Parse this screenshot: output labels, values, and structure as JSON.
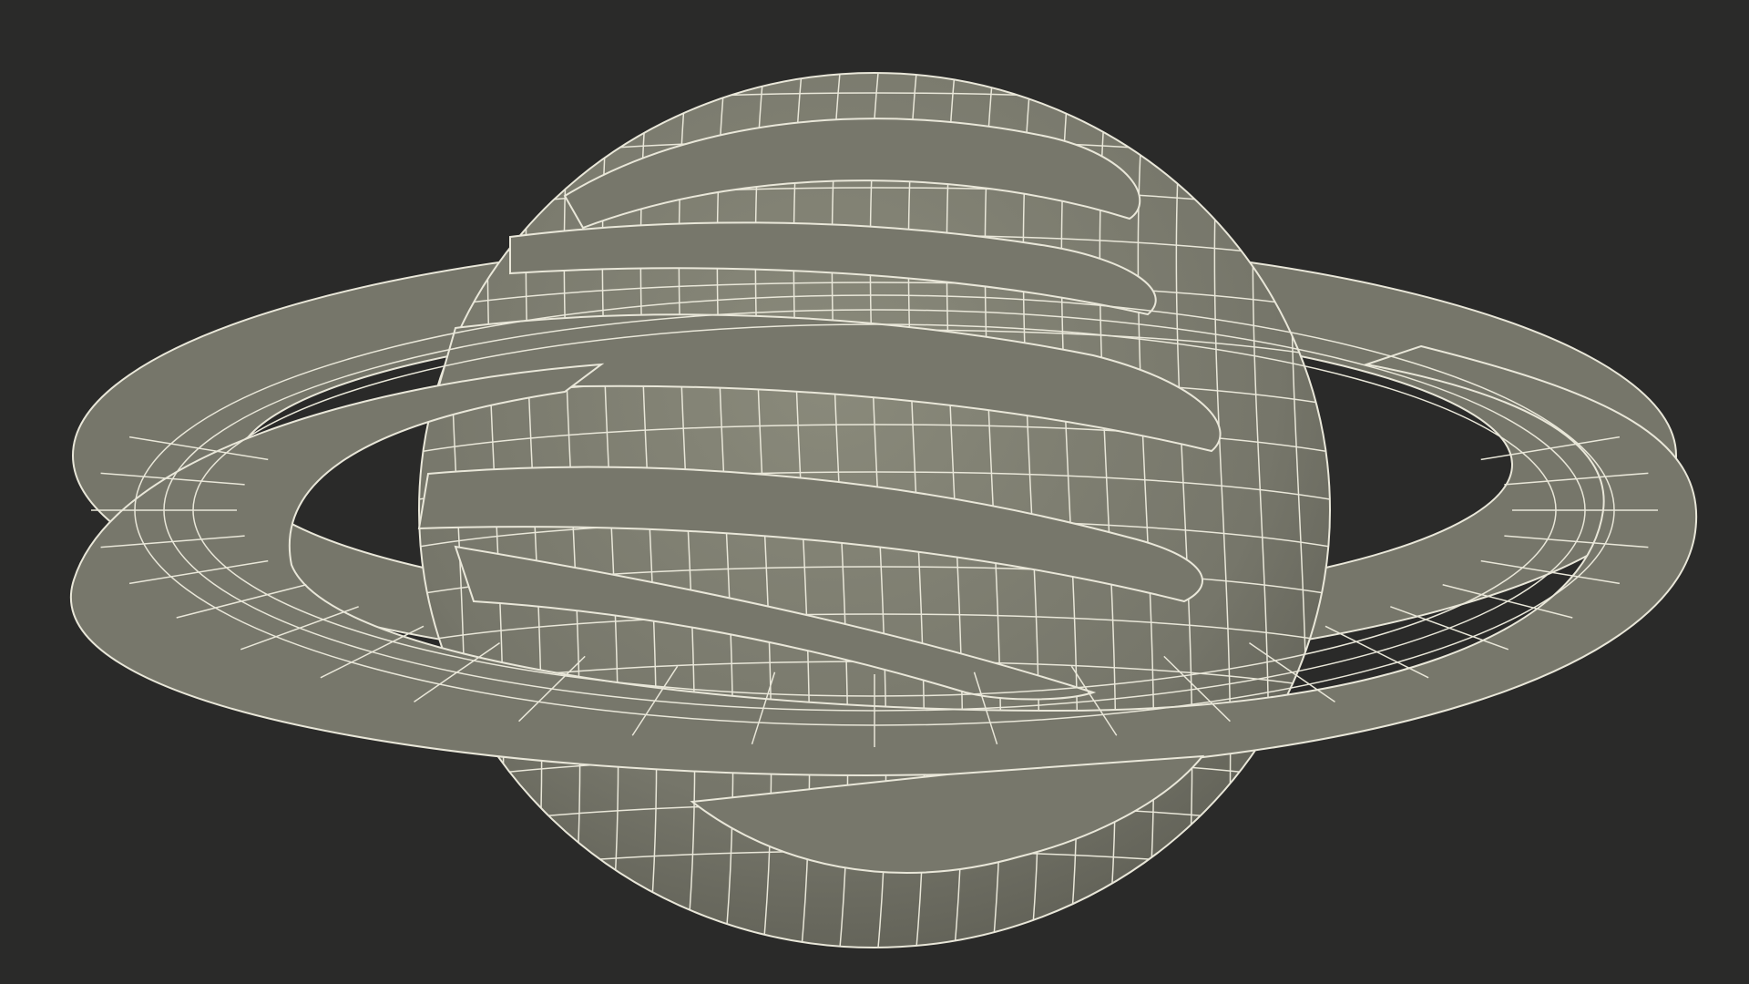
{
  "scene": {
    "subject": "saturn-wireframe-model",
    "colors": {
      "background": "#2a2a29",
      "surface": "#7b7b6c",
      "surface_dark": "#5f5f53",
      "wire": "#e9e7d9"
    }
  }
}
